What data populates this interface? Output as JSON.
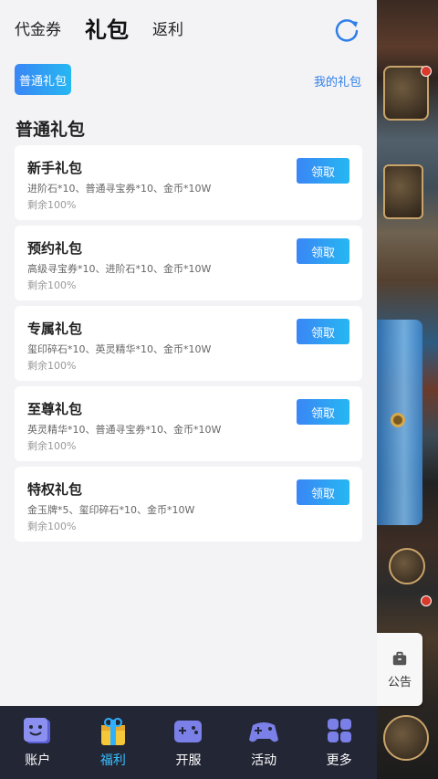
{
  "tabs": [
    {
      "label": "代金券"
    },
    {
      "label": "礼包"
    },
    {
      "label": "返利"
    }
  ],
  "filter": {
    "label": "普通礼包"
  },
  "my_gift": {
    "label": "我的礼包"
  },
  "section_title": "普通礼包",
  "gifts": [
    {
      "title": "新手礼包",
      "desc": "进阶石*10、普通寻宝券*10、金币*10W",
      "remain": "剩余100%",
      "button": "领取"
    },
    {
      "title": "预约礼包",
      "desc": "高级寻宝券*10、进阶石*10、金币*10W",
      "remain": "剩余100%",
      "button": "领取"
    },
    {
      "title": "专属礼包",
      "desc": "玺印碎石*10、英灵精华*10、金币*10W",
      "remain": "剩余100%",
      "button": "领取"
    },
    {
      "title": "至尊礼包",
      "desc": "英灵精华*10、普通寻宝券*10、金币*10W",
      "remain": "剩余100%",
      "button": "领取"
    },
    {
      "title": "特权礼包",
      "desc": "金玉牌*5、玺印碎石*10、金币*10W",
      "remain": "剩余100%",
      "button": "领取"
    }
  ],
  "notice": {
    "label": "公告"
  },
  "nav": [
    {
      "label": "账户",
      "icon": "account-icon"
    },
    {
      "label": "福利",
      "icon": "gift-icon"
    },
    {
      "label": "开服",
      "icon": "gamepad-icon"
    },
    {
      "label": "活动",
      "icon": "controller-icon"
    },
    {
      "label": "更多",
      "icon": "grid-icon"
    }
  ],
  "colors": {
    "accent": "#2f7fe9",
    "nav_active": "#38c0ff",
    "nav_bg": "#232635"
  }
}
